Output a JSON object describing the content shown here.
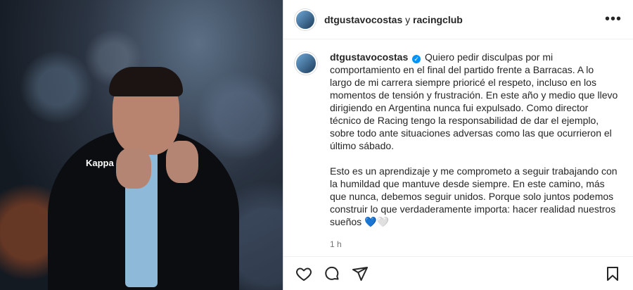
{
  "post": {
    "header": {
      "user": "dtgustavocostas",
      "joiner": "y",
      "collab": "racingclub"
    },
    "caption": {
      "username": "dtgustavocostas",
      "paragraph1": "Quiero pedir disculpas por mi comportamiento en el final del partido frente a Barracas. A lo largo de mi carrera siempre prioricé el respeto, incluso en los momentos de tensión y frustración. En este año y medio que llevo dirigiendo en Argentina nunca fui expulsado. Como director técnico de Racing tengo la responsabilidad de dar el ejemplo, sobre todo ante situaciones adversas como las que ocurrieron el último sábado.",
      "paragraph2": "Esto es un aprendizaje y me comprometo a seguir trabajando con la humildad que mantuve desde siempre. En este camino, más que nunca, debemos seguir unidos. Porque solo juntos podemos construir lo que verdaderamente importa: hacer realidad nuestros sueños 💙🤍"
    },
    "time": "1 h",
    "photo_brand": "Kappa"
  },
  "icons": {
    "more": "more-options-icon",
    "like": "heart-icon",
    "comment": "comment-icon",
    "share": "send-icon",
    "save": "bookmark-icon",
    "verified": "verified-badge-icon"
  },
  "colors": {
    "verified": "#0095f6",
    "text": "#262626",
    "muted": "#737373"
  }
}
